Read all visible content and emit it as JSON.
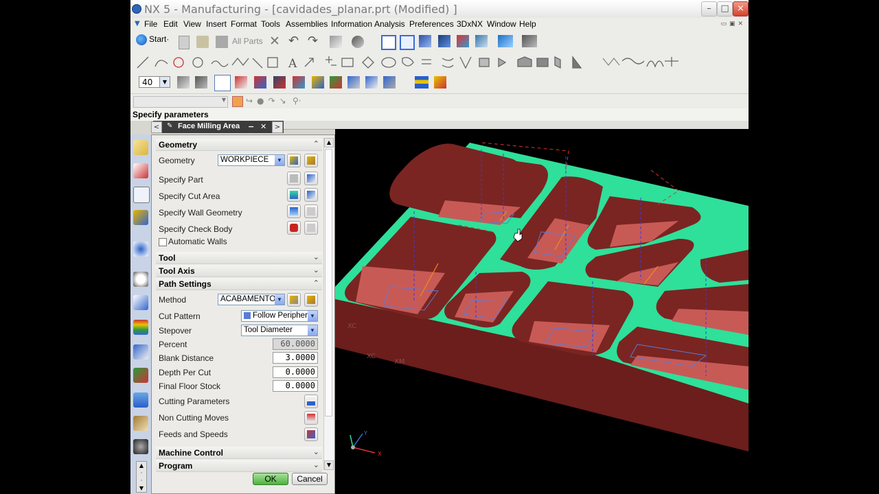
{
  "window": {
    "title": "NX 5 - Manufacturing - [cavidades_planar.prt (Modified) ]",
    "min": "–",
    "max": "□",
    "close": "×"
  },
  "menu": [
    "File",
    "Edit",
    "View",
    "Insert",
    "Format",
    "Tools",
    "Assemblies",
    "Information",
    "Analysis",
    "Preferences",
    "3DxNX",
    "Window",
    "Help"
  ],
  "toolbar": {
    "start_label": "Start·",
    "all_parts": "All Parts",
    "zoom_value": "40"
  },
  "cue_line": "Specify parameters",
  "dialog": {
    "title": "Face Milling Area",
    "sections": {
      "geometry": "Geometry",
      "tool": "Tool",
      "tool_axis": "Tool Axis",
      "path_settings": "Path Settings",
      "machine_control": "Machine Control",
      "program": "Program"
    },
    "geometry_label": "Geometry",
    "geometry_value": "WORKPIECE",
    "specify_part": "Specify Part",
    "specify_cut_area": "Specify Cut Area",
    "specify_wall": "Specify Wall Geometry",
    "specify_check": "Specify Check Body",
    "automatic_walls": "Automatic Walls",
    "method_label": "Method",
    "method_value": "ACABAMENTO",
    "cut_pattern_label": "Cut Pattern",
    "cut_pattern_value": "Follow Periphery",
    "stepover_label": "Stepover",
    "stepover_value": "Tool Diameter",
    "percent_label": "Percent",
    "percent_value": "60.0000",
    "blank_distance_label": "Blank Distance",
    "blank_distance_value": "3.0000",
    "depth_per_cut_label": "Depth Per Cut",
    "depth_per_cut_value": "0.0000",
    "final_floor_label": "Final Floor Stock",
    "final_floor_value": "0.0000",
    "cutting_parameters": "Cutting Parameters",
    "non_cutting_moves": "Non Cutting Moves",
    "feeds_speeds": "Feeds and Speeds",
    "ok": "OK",
    "cancel": "Cancel"
  },
  "viewport": {
    "labels": [
      "XC",
      "XC",
      "XM",
      "Y",
      "X"
    ],
    "colors": {
      "floor": "#2ee09a",
      "wall": "#6b1e1c",
      "pocket_floor": "#c85a56",
      "toolpath_blue": "#5b7bd6",
      "toolpath_orange": "#f08a1a"
    }
  }
}
